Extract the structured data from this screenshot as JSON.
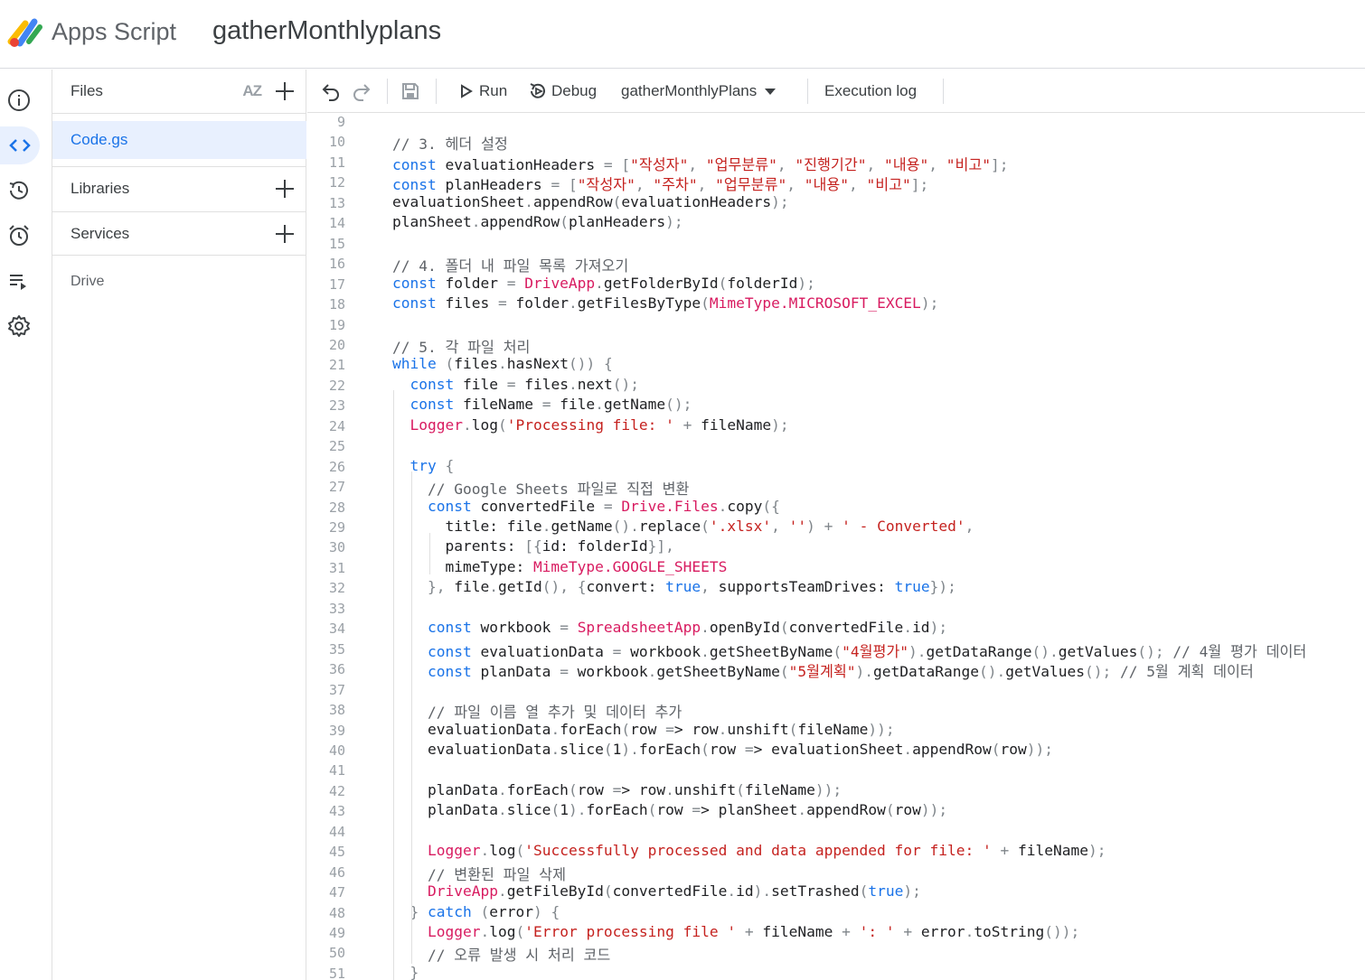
{
  "header": {
    "app_name": "Apps Script",
    "project_name": "gatherMonthlyplans"
  },
  "rail": {
    "items": [
      {
        "name": "overview",
        "icon": "info-icon"
      },
      {
        "name": "editor",
        "icon": "code-icon",
        "active": true
      },
      {
        "name": "executions",
        "icon": "history-icon"
      },
      {
        "name": "triggers",
        "icon": "alarm-icon"
      },
      {
        "name": "logs",
        "icon": "playlist-icon"
      },
      {
        "name": "settings",
        "icon": "gear-icon"
      }
    ]
  },
  "files_panel": {
    "files_label": "Files",
    "sort_label": "AZ",
    "files": [
      {
        "name": "Code.gs",
        "selected": true
      }
    ],
    "libraries_label": "Libraries",
    "services_label": "Services",
    "services": [
      {
        "name": "Drive"
      }
    ]
  },
  "toolbar": {
    "run_label": "Run",
    "debug_label": "Debug",
    "function_select": "gatherMonthlyPlans",
    "execution_log_label": "Execution log"
  },
  "editor": {
    "lines": [
      {
        "n": "9",
        "code": ""
      },
      {
        "n": "10",
        "code": "// 3. 헤더 설정"
      },
      {
        "n": "11",
        "code": "const evaluationHeaders = [\"작성자\", \"업무분류\", \"진행기간\", \"내용\", \"비고\"];"
      },
      {
        "n": "12",
        "code": "const planHeaders = [\"작성자\", \"주차\", \"업무분류\", \"내용\", \"비고\"];"
      },
      {
        "n": "13",
        "code": "evaluationSheet.appendRow(evaluationHeaders);"
      },
      {
        "n": "14",
        "code": "planSheet.appendRow(planHeaders);"
      },
      {
        "n": "15",
        "code": ""
      },
      {
        "n": "16",
        "code": "// 4. 폴더 내 파일 목록 가져오기"
      },
      {
        "n": "17",
        "code": "const folder = DriveApp.getFolderById(folderId);"
      },
      {
        "n": "18",
        "code": "const files = folder.getFilesByType(MimeType.MICROSOFT_EXCEL);"
      },
      {
        "n": "19",
        "code": ""
      },
      {
        "n": "20",
        "code": "// 5. 각 파일 처리"
      },
      {
        "n": "21",
        "code": "while (files.hasNext()) {"
      },
      {
        "n": "22",
        "code": "  const file = files.next();"
      },
      {
        "n": "23",
        "code": "  const fileName = file.getName();"
      },
      {
        "n": "24",
        "code": "  Logger.log('Processing file: ' + fileName);"
      },
      {
        "n": "25",
        "code": ""
      },
      {
        "n": "26",
        "code": "  try {"
      },
      {
        "n": "27",
        "code": "    // Google Sheets 파일로 직접 변환"
      },
      {
        "n": "28",
        "code": "    const convertedFile = Drive.Files.copy({"
      },
      {
        "n": "29",
        "code": "      title: file.getName().replace('.xlsx', '') + ' - Converted',"
      },
      {
        "n": "30",
        "code": "      parents: [{id: folderId}],"
      },
      {
        "n": "31",
        "code": "      mimeType: MimeType.GOOGLE_SHEETS"
      },
      {
        "n": "32",
        "code": "    }, file.getId(), {convert: true, supportsTeamDrives: true});"
      },
      {
        "n": "33",
        "code": ""
      },
      {
        "n": "34",
        "code": "    const workbook = SpreadsheetApp.openById(convertedFile.id);"
      },
      {
        "n": "35",
        "code": "    const evaluationData = workbook.getSheetByName(\"4월평가\").getDataRange().getValues(); // 4월 평가 데이터"
      },
      {
        "n": "36",
        "code": "    const planData = workbook.getSheetByName(\"5월계획\").getDataRange().getValues(); // 5월 계획 데이터"
      },
      {
        "n": "37",
        "code": ""
      },
      {
        "n": "38",
        "code": "    // 파일 이름 열 추가 및 데이터 추가"
      },
      {
        "n": "39",
        "code": "    evaluationData.forEach(row => row.unshift(fileName));"
      },
      {
        "n": "40",
        "code": "    evaluationData.slice(1).forEach(row => evaluationSheet.appendRow(row));"
      },
      {
        "n": "41",
        "code": ""
      },
      {
        "n": "42",
        "code": "    planData.forEach(row => row.unshift(fileName));"
      },
      {
        "n": "43",
        "code": "    planData.slice(1).forEach(row => planSheet.appendRow(row));"
      },
      {
        "n": "44",
        "code": ""
      },
      {
        "n": "45",
        "code": "    Logger.log('Successfully processed and data appended for file: ' + fileName);"
      },
      {
        "n": "46",
        "code": "    // 변환된 파일 삭제"
      },
      {
        "n": "47",
        "code": "    DriveApp.getFileById(convertedFile.id).setTrashed(true);"
      },
      {
        "n": "48",
        "code": "  } catch (error) {"
      },
      {
        "n": "49",
        "code": "    Logger.log('Error processing file ' + fileName + ': ' + error.toString());"
      },
      {
        "n": "50",
        "code": "    // 오류 발생 시 처리 코드"
      },
      {
        "n": "51",
        "code": "  }"
      }
    ]
  },
  "colors": {
    "accent": "#1a73e8",
    "keyword": "#1a73e8",
    "string": "#c5221f",
    "builtin": "#d81b60",
    "comment": "#5f6368",
    "selected_bg": "#e8f0fe"
  }
}
